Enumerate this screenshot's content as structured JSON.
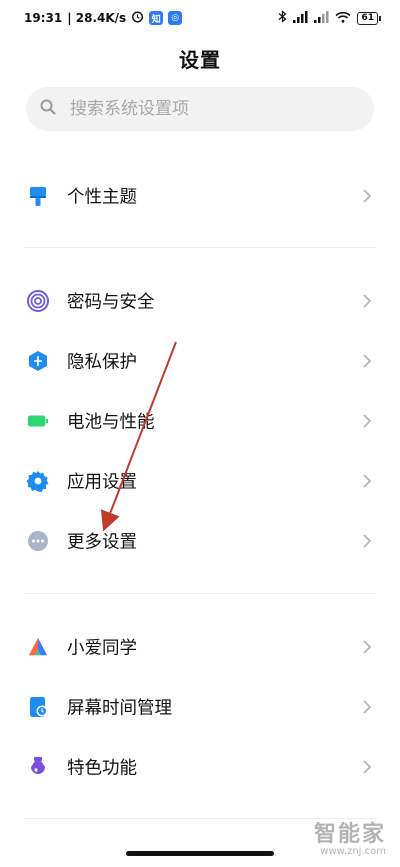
{
  "status": {
    "time": "19:31",
    "speed": "| 28.4K/s",
    "battery": "61",
    "app1": "知",
    "app2": "◎"
  },
  "header": {
    "title": "设置"
  },
  "search": {
    "placeholder": "搜索系统设置项"
  },
  "items": [
    {
      "label": "个性主题",
      "icon": "theme-brush-icon",
      "color": "#1e8cf0"
    },
    {
      "label": "密码与安全",
      "icon": "fingerprint-icon",
      "color": "#6b5be6"
    },
    {
      "label": "隐私保护",
      "icon": "privacy-shield-icon",
      "color": "#1e8cf0"
    },
    {
      "label": "电池与性能",
      "icon": "battery-icon",
      "color": "#2fd672"
    },
    {
      "label": "应用设置",
      "icon": "gear-icon",
      "color": "#1e8cf0"
    },
    {
      "label": "更多设置",
      "icon": "more-dots-icon",
      "color": "#aab4c8"
    },
    {
      "label": "小爱同学",
      "icon": "xiaoai-icon",
      "color": "#ff6a3d"
    },
    {
      "label": "屏幕时间管理",
      "icon": "screen-time-icon",
      "color": "#1e8cf0"
    },
    {
      "label": "特色功能",
      "icon": "features-icon",
      "color": "#7a4fe0"
    }
  ],
  "watermark": {
    "name": "智能家",
    "url": "www.znj.com"
  },
  "annotation": {
    "arrow_color": "#c0392b"
  }
}
